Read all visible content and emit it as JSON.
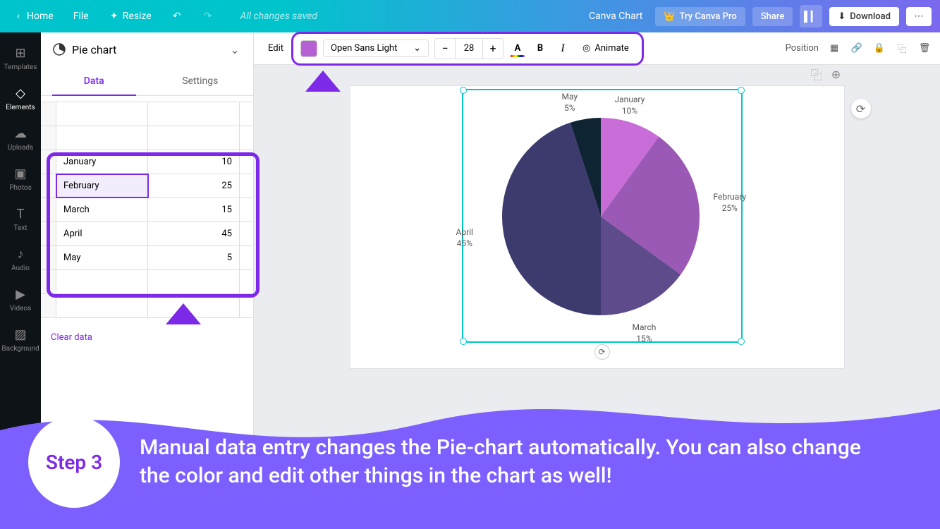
{
  "topbar": {
    "home": "Home",
    "file": "File",
    "resize": "Resize",
    "status": "All changes saved",
    "title": "Canva Chart",
    "try_pro": "Try Canva Pro",
    "share": "Share",
    "download": "Download"
  },
  "sidebar": {
    "items": [
      "Templates",
      "Elements",
      "Uploads",
      "Photos",
      "Text",
      "Audio",
      "Videos",
      "Background"
    ]
  },
  "panel": {
    "chart_type": "Pie chart",
    "tab_data": "Data",
    "tab_settings": "Settings",
    "clear": "Clear data"
  },
  "toolbar": {
    "edit": "Edit",
    "font": "Open Sans Light",
    "size": "28",
    "animate": "Animate",
    "position": "Position"
  },
  "chart_data": {
    "type": "pie",
    "categories": [
      "January",
      "February",
      "March",
      "April",
      "May"
    ],
    "values": [
      10,
      25,
      15,
      45,
      5
    ],
    "percentages": [
      "10%",
      "25%",
      "15%",
      "45%",
      "5%"
    ],
    "colors": [
      "#c86dd7",
      "#9b59b6",
      "#5e4b8b",
      "#3d3a6e",
      "#0e2433"
    ],
    "title": "",
    "selected_row": 1
  },
  "step": {
    "badge": "Step 3",
    "text": "Manual data entry changes the Pie-chart automatically. You can also change the color and edit other things in the chart as well!"
  }
}
